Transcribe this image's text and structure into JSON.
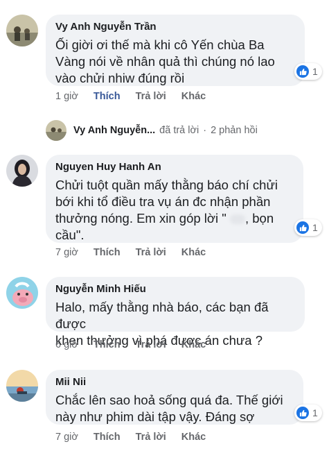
{
  "comments": [
    {
      "author": "Vy Anh Nguyễn Trần",
      "lines": [
        "Ối giời ơi thế mà khi cô Yến chùa Ba",
        "Vàng nói về nhân quả thì chúng nó lao",
        "vào chửi nhiw đúng rồi"
      ],
      "reaction_count": "1",
      "time": "1 giờ",
      "like_label": "Thích",
      "reply_label": "Trả lời",
      "more_label": "Khác"
    },
    {
      "author": "Nguyen Huy Hanh An",
      "lines": [
        "Chửi tuột quần mấy thằng báo chí chửi",
        "bới khi tổ điều tra vụ án đc nhận phần",
        "thưởng nóng. Em xin góp lời \"",
        "cầu\"."
      ],
      "line3_tail": ", bọn",
      "reaction_count": "1",
      "time": "7 giờ",
      "like_label": "Thích",
      "reply_label": "Trả lời",
      "more_label": "Khác"
    },
    {
      "author": "Nguyễn Minh Hiếu",
      "lines": [
        "Halo, mấy thằng nhà báo, các bạn đã được",
        "khen thưởng vì phá được án chưa ?"
      ],
      "time": "6 giờ",
      "like_label": "Thích",
      "reply_label": "Trả lời",
      "more_label": "Khác"
    },
    {
      "author": "Mii Nii",
      "lines": [
        "Chắc lên sao hoả sống quá đa. Thế giới",
        "này như phim dài tập vậy. Đáng sợ"
      ],
      "reaction_count": "1",
      "time": "7 giờ",
      "like_label": "Thích",
      "reply_label": "Trả lời",
      "more_label": "Khác"
    }
  ],
  "reply_summary": {
    "name": "Vy Anh Nguyễn...",
    "action": "đã trả lời",
    "separator": "·",
    "count": "2 phản hồi"
  },
  "colors": {
    "bubble": "#f0f2f5",
    "like_blue": "#1b74e4",
    "like_active": "#385898",
    "meta_gray": "#65676b"
  }
}
